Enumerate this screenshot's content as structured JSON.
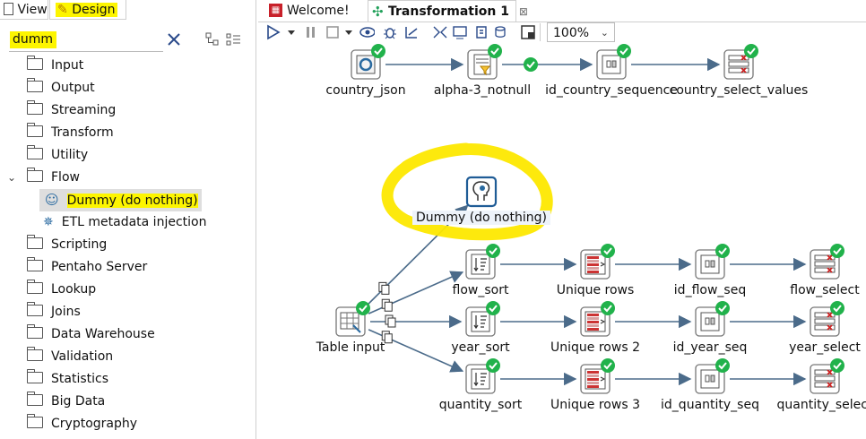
{
  "left_tabs": {
    "view": "View",
    "design": "Design"
  },
  "search": {
    "value": "dumm"
  },
  "tree": {
    "items": [
      "Input",
      "Output",
      "Streaming",
      "Transform",
      "Utility",
      "Flow"
    ],
    "flow_children": [
      "Dummy (do nothing)",
      "ETL metadata injection"
    ],
    "items_after": [
      "Scripting",
      "Pentaho Server",
      "Lookup",
      "Joins",
      "Data Warehouse",
      "Validation",
      "Statistics",
      "Big Data",
      "Cryptography"
    ]
  },
  "right_tabs": {
    "welcome": "Welcome!",
    "transformation": "Transformation 1",
    "close": "⊠"
  },
  "toolbar": {
    "zoom": "100%"
  },
  "steps": {
    "country_json": "country_json",
    "alpha": "alpha-3_notnull",
    "id_country": "id_country_sequence",
    "country_select": "country_select_values",
    "dummy": "Dummy (do nothing)",
    "table_input": "Table input",
    "flow_sort": "flow_sort",
    "unique1": "Unique rows",
    "id_flow": "id_flow_seq",
    "flow_select": "flow_select",
    "year_sort": "year_sort",
    "unique2": "Unique rows 2",
    "id_year": "id_year_seq",
    "year_select": "year_select",
    "quantity_sort": "quantity_sort",
    "unique3": "Unique rows 3",
    "id_quantity": "id_quantity_seq",
    "quantity_select": "quantity_select"
  },
  "colors": {
    "highlight": "#fdf500",
    "ok": "#21b24b",
    "hop": "#4b6b8a",
    "accent": "#2a6aa0"
  }
}
